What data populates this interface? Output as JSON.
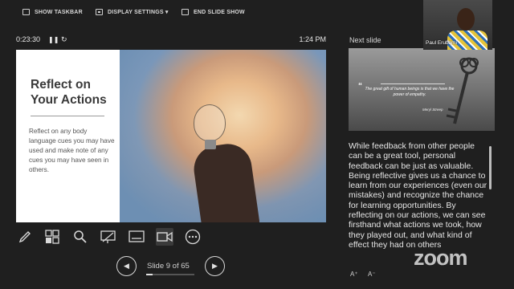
{
  "toolbar": {
    "show_taskbar": "SHOW TASKBAR",
    "display_settings": "DISPLAY SETTINGS ▾",
    "end_slide_show": "END SLIDE SHOW"
  },
  "status": {
    "timer": "0:23:30",
    "clock": "1:24 PM"
  },
  "slide": {
    "title": "Reflect on Your Actions",
    "body": "Reflect on any body language cues you may have used and make note of any cues you may have seen in others."
  },
  "tools": [
    "pen-icon",
    "slides-grid-icon",
    "zoom-search-icon",
    "pointer-screen-icon",
    "subtitles-icon",
    "camera-icon",
    "more-icon"
  ],
  "navigation": {
    "slide_counter": "Slide 9 of 65",
    "current_slide": 9,
    "total_slides": 65,
    "progress_fraction": 0.138
  },
  "next_slide": {
    "label": "Next slide",
    "quote": "The great gift of human beings is that we have the power of empathy.",
    "author": "Meryl Streep"
  },
  "participant": {
    "name": "Paul Erubami"
  },
  "notes": {
    "text": "While feedback from other people can be a great tool, personal feedback can be just as valuable. Being reflective gives us a chance to learn from our experiences (even our mistakes) and recognize the chance for learning opportunities. By reflecting on our actions, we can see firsthand what actions we took, how they played out, and what kind of effect they had on others"
  },
  "watermark": "zoom",
  "font_controls": [
    "A⁺",
    "A⁻"
  ]
}
